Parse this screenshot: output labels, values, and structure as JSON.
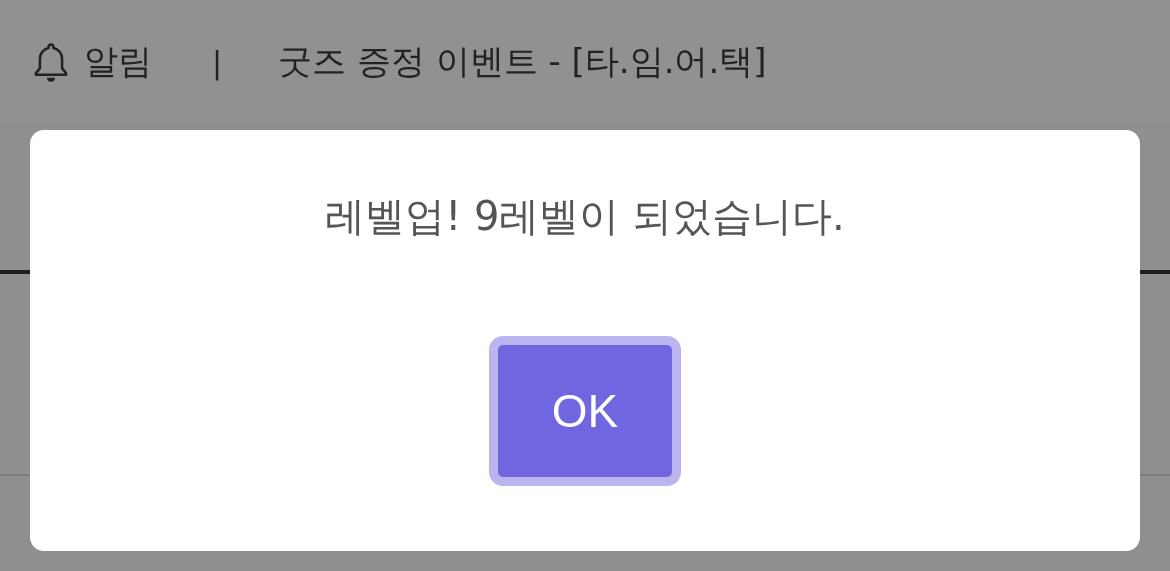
{
  "header": {
    "title": "알림",
    "separator": "|",
    "event_title": "굿즈 증정 이벤트 - [타.임.어.택]"
  },
  "dialog": {
    "message": "레벨업! 9레벨이 되었습니다.",
    "button": "OK"
  }
}
